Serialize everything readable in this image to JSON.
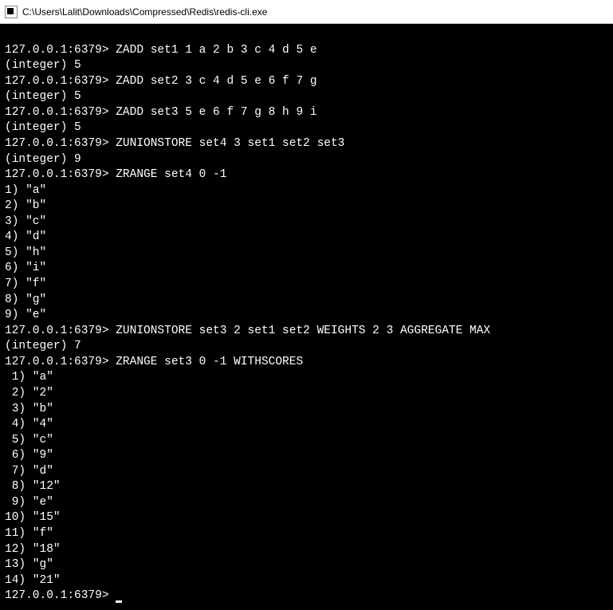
{
  "window": {
    "title": "C:\\Users\\Lalit\\Downloads\\Compressed\\Redis\\redis-cli.exe"
  },
  "prompt": "127.0.0.1:6379>",
  "lines": [
    {
      "type": "cmd",
      "text": "127.0.0.1:6379> ZADD set1 1 a 2 b 3 c 4 d 5 e"
    },
    {
      "type": "out",
      "text": "(integer) 5"
    },
    {
      "type": "cmd",
      "text": "127.0.0.1:6379> ZADD set2 3 c 4 d 5 e 6 f 7 g"
    },
    {
      "type": "out",
      "text": "(integer) 5"
    },
    {
      "type": "cmd",
      "text": "127.0.0.1:6379> ZADD set3 5 e 6 f 7 g 8 h 9 i"
    },
    {
      "type": "out",
      "text": "(integer) 5"
    },
    {
      "type": "cmd",
      "text": "127.0.0.1:6379> ZUNIONSTORE set4 3 set1 set2 set3"
    },
    {
      "type": "out",
      "text": "(integer) 9"
    },
    {
      "type": "cmd",
      "text": "127.0.0.1:6379> ZRANGE set4 0 -1"
    },
    {
      "type": "out",
      "text": "1) \"a\""
    },
    {
      "type": "out",
      "text": "2) \"b\""
    },
    {
      "type": "out",
      "text": "3) \"c\""
    },
    {
      "type": "out",
      "text": "4) \"d\""
    },
    {
      "type": "out",
      "text": "5) \"h\""
    },
    {
      "type": "out",
      "text": "6) \"i\""
    },
    {
      "type": "out",
      "text": "7) \"f\""
    },
    {
      "type": "out",
      "text": "8) \"g\""
    },
    {
      "type": "out",
      "text": "9) \"e\""
    },
    {
      "type": "cmd",
      "text": "127.0.0.1:6379> ZUNIONSTORE set3 2 set1 set2 WEIGHTS 2 3 AGGREGATE MAX"
    },
    {
      "type": "out",
      "text": "(integer) 7"
    },
    {
      "type": "cmd",
      "text": "127.0.0.1:6379> ZRANGE set3 0 -1 WITHSCORES"
    },
    {
      "type": "out",
      "text": " 1) \"a\""
    },
    {
      "type": "out",
      "text": " 2) \"2\""
    },
    {
      "type": "out",
      "text": " 3) \"b\""
    },
    {
      "type": "out",
      "text": " 4) \"4\""
    },
    {
      "type": "out",
      "text": " 5) \"c\""
    },
    {
      "type": "out",
      "text": " 6) \"9\""
    },
    {
      "type": "out",
      "text": " 7) \"d\""
    },
    {
      "type": "out",
      "text": " 8) \"12\""
    },
    {
      "type": "out",
      "text": " 9) \"e\""
    },
    {
      "type": "out",
      "text": "10) \"15\""
    },
    {
      "type": "out",
      "text": "11) \"f\""
    },
    {
      "type": "out",
      "text": "12) \"18\""
    },
    {
      "type": "out",
      "text": "13) \"g\""
    },
    {
      "type": "out",
      "text": "14) \"21\""
    }
  ],
  "final_prompt": "127.0.0.1:6379> "
}
